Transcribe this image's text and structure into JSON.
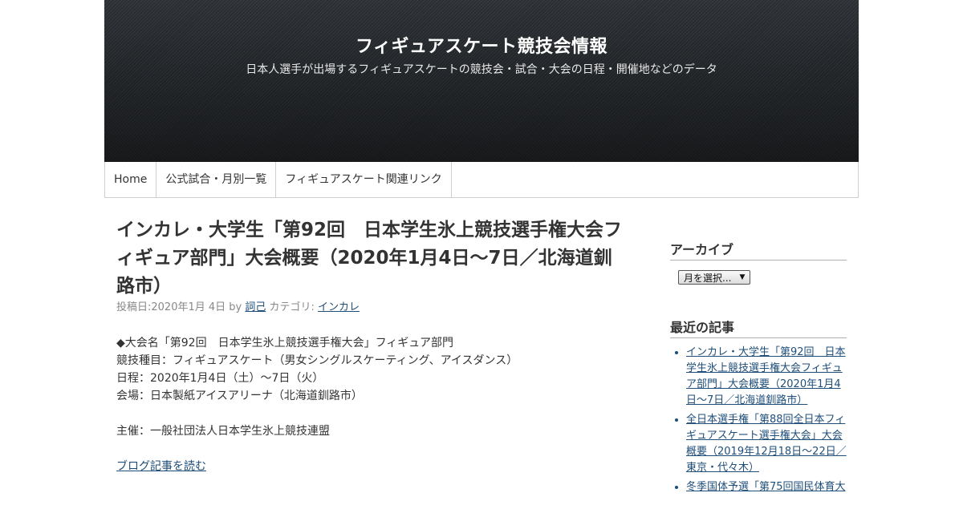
{
  "header": {
    "site_title": "フィギュアスケート競技会情報",
    "site_description": "日本人選手が出場するフィギュアスケートの競技会・試合・大会の日程・開催地などのデータ"
  },
  "nav": {
    "items": [
      "Home",
      "公式試合・月別一覧",
      "フィギュアスケート関連リンク"
    ]
  },
  "post": {
    "title": "インカレ・大学生「第92回　日本学生氷上競技選手権大会フィギュア部門」大会概要（2020年1月4日～7日／北海道釧路市）",
    "meta_posted": "投稿日:2020年1月 4日 by ",
    "author": "詞己",
    "meta_category": " カテゴリ: ",
    "category": "インカレ",
    "body_lines": [
      "◆大会名「第92回　日本学生氷上競技選手権大会」フィギュア部門",
      "競技種目：フィギュアスケート（男女シングルスケーティング、アイスダンス）",
      "日程：2020年1月4日（土）～7日（火）",
      "会場：日本製紙アイスアリーナ（北海道釧路市）"
    ],
    "organizer": "主催：一般社団法人日本学生氷上競技連盟",
    "read_more": "ブログ記事を読む"
  },
  "sidebar": {
    "archive_title": "アーカイブ",
    "archive_select": "月を選択...",
    "recent_title": "最近の記事",
    "recent_posts": [
      "インカレ・大学生「第92回　日本学生氷上競技選手権大会フィギュア部門」大会概要（2020年1月4日～7日／北海道釧路市）",
      "全日本選手権「第88回全日本フィギュアスケート選手権大会」大会概要（2019年12月18日～22日／東京・代々木）",
      "冬季国体予選「第75回国民体育大"
    ]
  },
  "colors": {
    "link": "#1f4e79",
    "header_bg": "#33373b"
  }
}
